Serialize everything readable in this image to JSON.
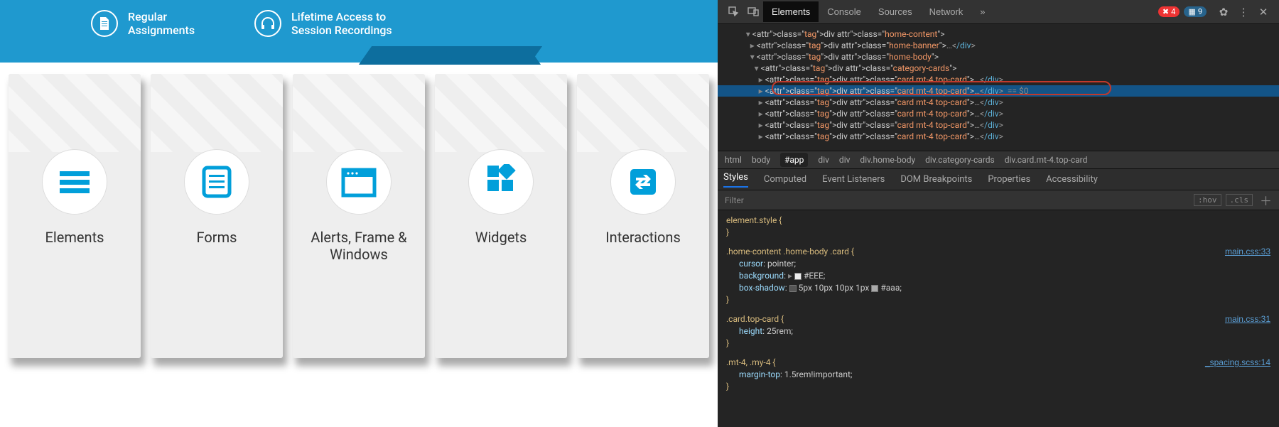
{
  "banner": {
    "features": [
      {
        "label": "Regular\nAssignments"
      },
      {
        "label": "Lifetime Access to\nSession Recordings"
      }
    ]
  },
  "cards": [
    {
      "label": "Elements"
    },
    {
      "label": "Forms"
    },
    {
      "label": "Alerts, Frame & Windows"
    },
    {
      "label": "Widgets"
    },
    {
      "label": "Interactions"
    }
  ],
  "devtools": {
    "tabs": [
      "Elements",
      "Console",
      "Sources",
      "Network"
    ],
    "more_glyph": "»",
    "err_count": "4",
    "warn_count": "9",
    "dom_lines": [
      {
        "indent": 5,
        "tri": "▾",
        "text": "<div class=\"home-content\">",
        "close": ""
      },
      {
        "indent": 6,
        "tri": "▸",
        "text": "<div class=\"home-banner\">",
        "close": "…</div>"
      },
      {
        "indent": 6,
        "tri": "▾",
        "text": "<div class=\"home-body\">",
        "close": ""
      },
      {
        "indent": 7,
        "tri": "▾",
        "text": "<div class=\"category-cards\">",
        "close": ""
      },
      {
        "indent": 8,
        "tri": "▸",
        "text": "<div class=\"card mt-4 top-card\">",
        "close": "…</div>"
      },
      {
        "indent": 8,
        "tri": "▸",
        "text": "<div class=\"card mt-4 top-card\">",
        "close": "…</div>",
        "eq": "  == $0",
        "sel": true
      },
      {
        "indent": 8,
        "tri": "▸",
        "text": "<div class=\"card mt-4 top-card\">",
        "close": "…</div>"
      },
      {
        "indent": 8,
        "tri": "▸",
        "text": "<div class=\"card mt-4 top-card\">",
        "close": "…</div>"
      },
      {
        "indent": 8,
        "tri": "▸",
        "text": "<div class=\"card mt-4 top-card\">",
        "close": "…</div>"
      },
      {
        "indent": 8,
        "tri": "▸",
        "text": "<div class=\"card mt-4 top-card\">",
        "close": "…</div>"
      }
    ],
    "crumbs": [
      "html",
      "body",
      "#app",
      "div",
      "div",
      "div.home-body",
      "div.category-cards",
      "div.card.mt-4.top-card"
    ],
    "crumb_active": "#app",
    "styles_tabs": [
      "Styles",
      "Computed",
      "Event Listeners",
      "DOM Breakpoints",
      "Properties",
      "Accessibility"
    ],
    "filter_label": "Filter",
    "hov": ":hov",
    "cls": ".cls",
    "rules": [
      {
        "selector": "element.style {",
        "props": [],
        "link": ""
      },
      {
        "selector": ".home-content .home-body .card {",
        "link": "main.css:33",
        "props": [
          {
            "name": "cursor",
            "value": "pointer;"
          },
          {
            "name": "background",
            "value": "#EEE;",
            "swatch": "#EEE",
            "tri": "▸"
          },
          {
            "name": "box-shadow",
            "value": "5px 10px 10px 1px #aaa;",
            "swatch2": "#aaa",
            "bsicon": true
          }
        ]
      },
      {
        "selector": ".card.top-card {",
        "link": "main.css:31",
        "props": [
          {
            "name": "height",
            "value": "25rem;"
          }
        ]
      },
      {
        "selector": ".mt-4, .my-4 {",
        "link": "_spacing.scss:14",
        "props": [
          {
            "name": "margin-top",
            "value": "1.5rem!important;"
          }
        ]
      }
    ]
  }
}
